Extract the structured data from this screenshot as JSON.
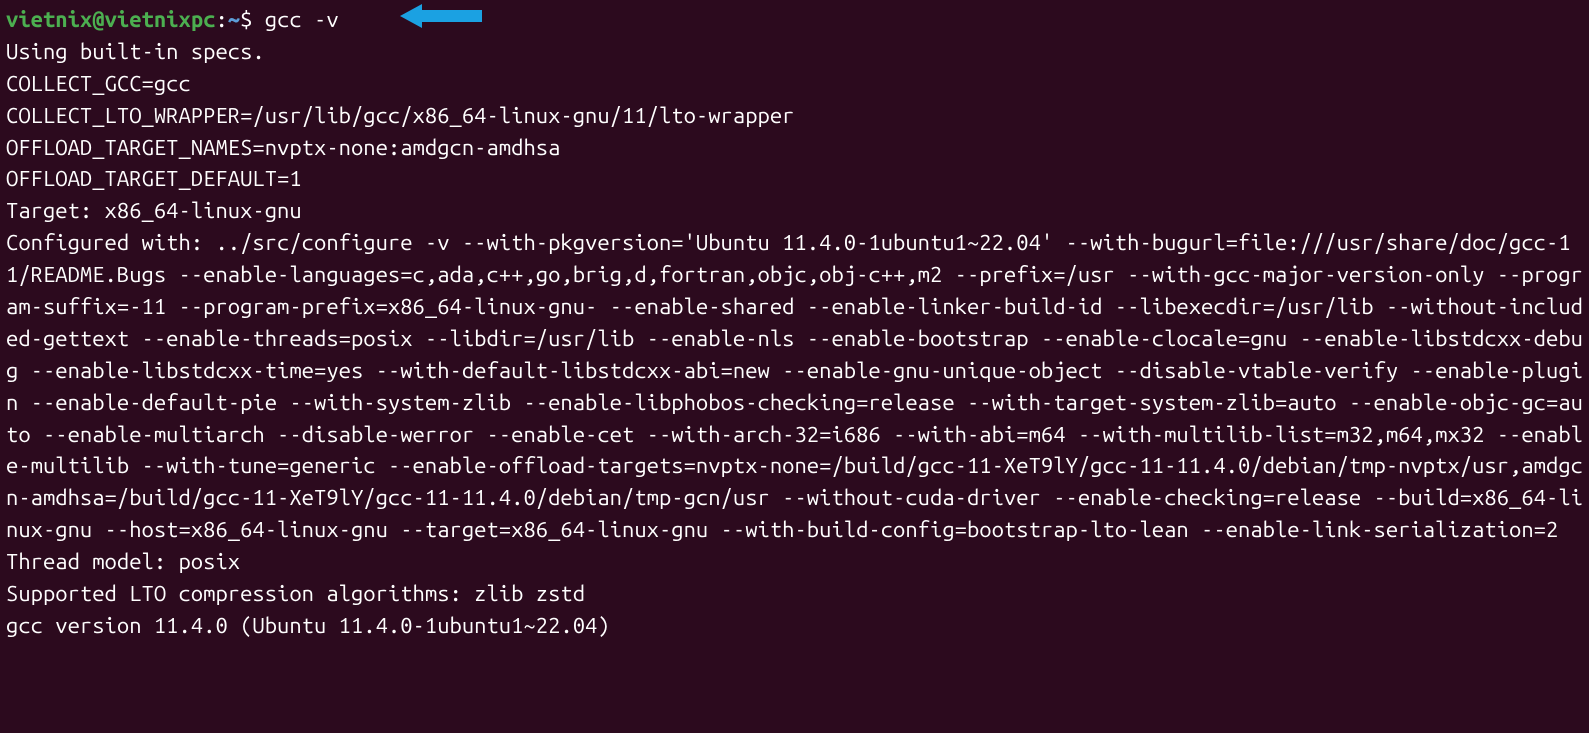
{
  "prompt": {
    "user": "vietnix",
    "at": "@",
    "host": "vietnixpc",
    "colon": ":",
    "tilde": "~",
    "dollar": "$ "
  },
  "command": "gcc -v",
  "output_lines": [
    "Using built-in specs.",
    "COLLECT_GCC=gcc",
    "COLLECT_LTO_WRAPPER=/usr/lib/gcc/x86_64-linux-gnu/11/lto-wrapper",
    "OFFLOAD_TARGET_NAMES=nvptx-none:amdgcn-amdhsa",
    "OFFLOAD_TARGET_DEFAULT=1",
    "Target: x86_64-linux-gnu",
    "Configured with: ../src/configure -v --with-pkgversion='Ubuntu 11.4.0-1ubuntu1~22.04' --with-bugurl=file:///usr/share/doc/gcc-11/README.Bugs --enable-languages=c,ada,c++,go,brig,d,fortran,objc,obj-c++,m2 --prefix=/usr --with-gcc-major-version-only --program-suffix=-11 --program-prefix=x86_64-linux-gnu- --enable-shared --enable-linker-build-id --libexecdir=/usr/lib --without-included-gettext --enable-threads=posix --libdir=/usr/lib --enable-nls --enable-bootstrap --enable-clocale=gnu --enable-libstdcxx-debug --enable-libstdcxx-time=yes --with-default-libstdcxx-abi=new --enable-gnu-unique-object --disable-vtable-verify --enable-plugin --enable-default-pie --with-system-zlib --enable-libphobos-checking=release --with-target-system-zlib=auto --enable-objc-gc=auto --enable-multiarch --disable-werror --enable-cet --with-arch-32=i686 --with-abi=m64 --with-multilib-list=m32,m64,mx32 --enable-multilib --with-tune=generic --enable-offload-targets=nvptx-none=/build/gcc-11-XeT9lY/gcc-11-11.4.0/debian/tmp-nvptx/usr,amdgcn-amdhsa=/build/gcc-11-XeT9lY/gcc-11-11.4.0/debian/tmp-gcn/usr --without-cuda-driver --enable-checking=release --build=x86_64-linux-gnu --host=x86_64-linux-gnu --target=x86_64-linux-gnu --with-build-config=bootstrap-lto-lean --enable-link-serialization=2",
    "Thread model: posix",
    "Supported LTO compression algorithms: zlib zstd",
    "gcc version 11.4.0 (Ubuntu 11.4.0-1ubuntu1~22.04)"
  ],
  "annotation": {
    "arrow_color": "#1ba1e2"
  }
}
